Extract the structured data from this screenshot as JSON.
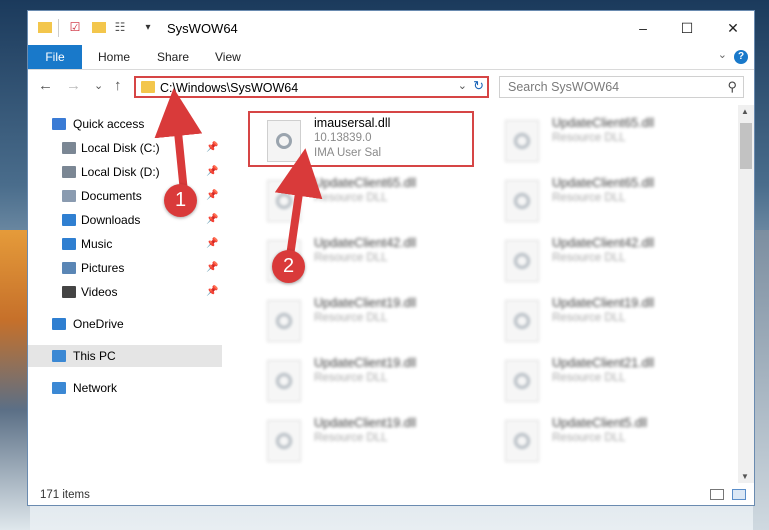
{
  "window": {
    "title": "SysWOW64",
    "controls": {
      "minimize": "–",
      "maximize": "☐",
      "close": "✕"
    }
  },
  "ribbon": {
    "tabs": [
      "File",
      "Home",
      "Share",
      "View"
    ],
    "help": "?",
    "collapse": "⌄"
  },
  "navigation": {
    "back": "←",
    "forward": "→",
    "recent": "⌄",
    "up": "↑",
    "address": "C:\\Windows\\SysWOW64",
    "search_placeholder": "Search SysWOW64"
  },
  "sidebar": {
    "items": [
      {
        "label": "Quick access",
        "icon": "star-icon"
      },
      {
        "label": "Local Disk (C:)",
        "icon": "drive-icon",
        "pinned": true
      },
      {
        "label": "Local Disk (D:)",
        "icon": "drive-icon",
        "pinned": true
      },
      {
        "label": "Documents",
        "icon": "documents-icon",
        "pinned": true
      },
      {
        "label": "Downloads",
        "icon": "download-icon",
        "pinned": true
      },
      {
        "label": "Music",
        "icon": "music-icon",
        "pinned": true
      },
      {
        "label": "Pictures",
        "icon": "pictures-icon",
        "pinned": true
      },
      {
        "label": "Videos",
        "icon": "videos-icon",
        "pinned": true
      },
      {
        "label": "OneDrive",
        "icon": "cloud-icon"
      },
      {
        "label": "This PC",
        "icon": "computer-icon",
        "selected": true
      },
      {
        "label": "Network",
        "icon": "network-icon"
      }
    ]
  },
  "files": {
    "highlighted": {
      "name": "imausersal.dll",
      "version": "10.13839.0",
      "description": "IMA User Sal"
    },
    "left_column": [
      {
        "name": "UpdateClient65.dll",
        "type": "Resource DLL"
      },
      {
        "name": "UpdateClient42.dll",
        "type": "Resource DLL"
      },
      {
        "name": "UpdateClient19.dll",
        "type": "Resource DLL"
      },
      {
        "name": "UpdateClient19.dll",
        "type": "Resource DLL"
      },
      {
        "name": "UpdateClient19.dll",
        "type": "Resource DLL"
      }
    ],
    "right_column": [
      {
        "name": "UpdateClient65.dll",
        "type": "Resource DLL"
      },
      {
        "name": "UpdateClient65.dll",
        "type": "Resource DLL"
      },
      {
        "name": "UpdateClient42.dll",
        "type": "Resource DLL"
      },
      {
        "name": "UpdateClient19.dll",
        "type": "Resource DLL"
      },
      {
        "name": "UpdateClient21.dll",
        "type": "Resource DLL"
      },
      {
        "name": "UpdateClient5.dll",
        "type": "Resource DLL"
      }
    ]
  },
  "status": {
    "item_count": "171 items"
  },
  "annotations": {
    "step1": "1",
    "step2": "2"
  },
  "colors": {
    "accent": "#1979ca",
    "highlight": "#d64545"
  }
}
